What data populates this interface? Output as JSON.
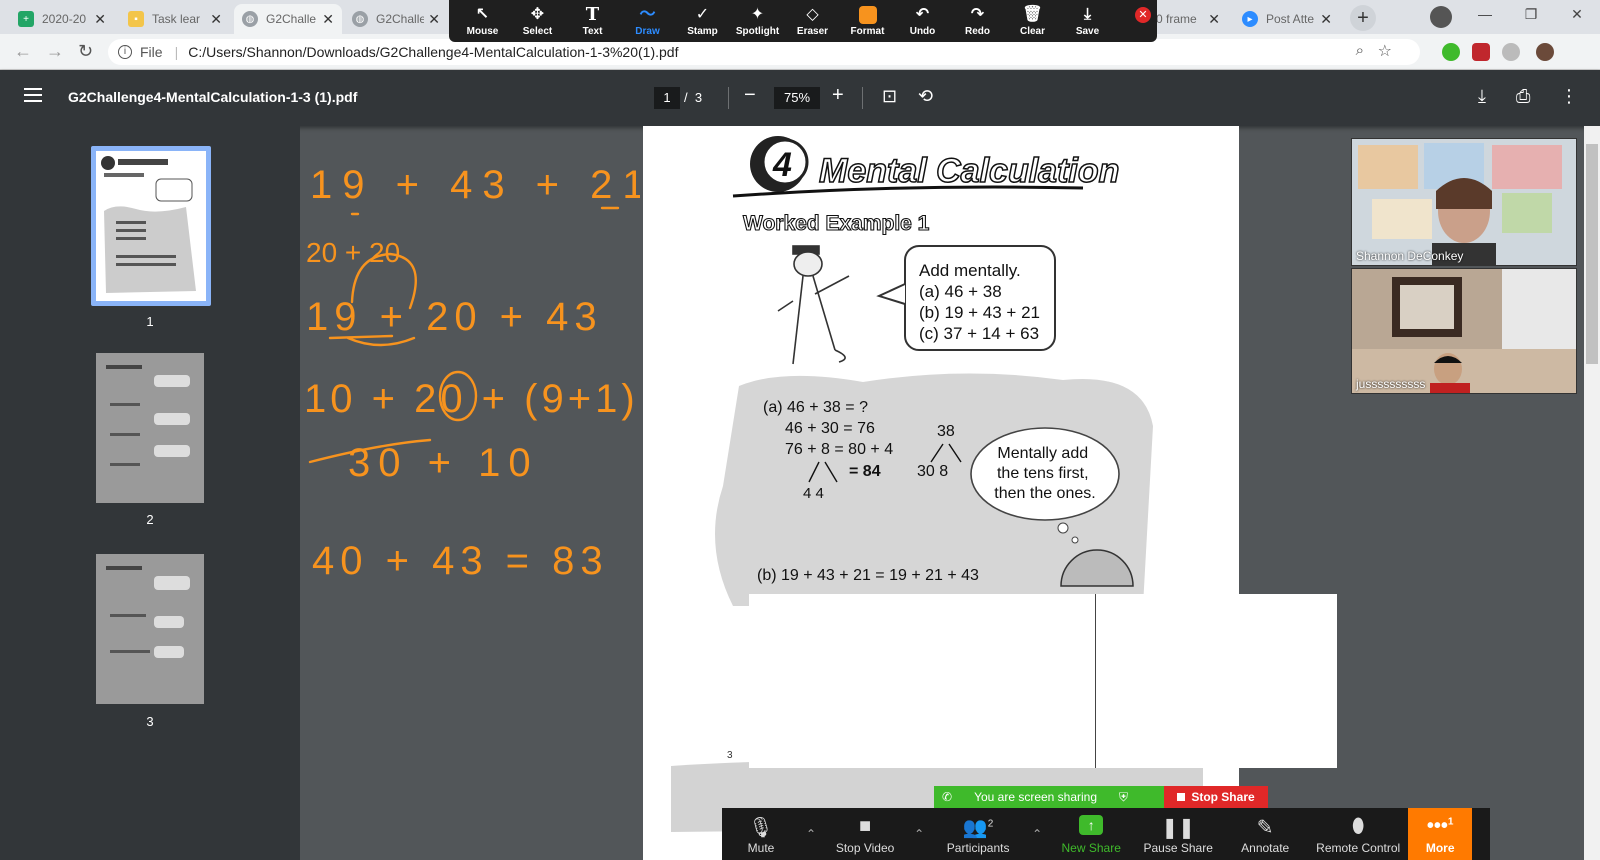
{
  "browser": {
    "tabs": [
      {
        "label": "2020-20",
        "icon": "sheets-icon"
      },
      {
        "label": "Task lear",
        "icon": "classroom-icon"
      },
      {
        "label": "G2Challe",
        "icon": "globe-icon"
      },
      {
        "label": "G2Challe",
        "icon": "globe-icon"
      },
      {
        "label": "0 frame",
        "icon": "record-icon"
      },
      {
        "label": "Post Atte",
        "icon": "zoom-icon"
      }
    ],
    "address": {
      "scheme_label": "File",
      "url": "C:/Users/Shannon/Downloads/G2Challenge4-MentalCalculation-1-3%20(1).pdf"
    }
  },
  "annotation_toolbar": {
    "tools": [
      {
        "label": "Mouse",
        "icon": "mouse-pointer-icon"
      },
      {
        "label": "Select",
        "icon": "move-icon"
      },
      {
        "label": "Text",
        "icon": "text-icon"
      },
      {
        "label": "Draw",
        "icon": "draw-icon",
        "active": true
      },
      {
        "label": "Stamp",
        "icon": "checkmark-icon"
      },
      {
        "label": "Spotlight",
        "icon": "spotlight-icon"
      },
      {
        "label": "Eraser",
        "icon": "eraser-icon"
      },
      {
        "label": "Format",
        "icon": "color-swatch-icon"
      },
      {
        "label": "Undo",
        "icon": "undo-icon"
      },
      {
        "label": "Redo",
        "icon": "redo-icon"
      },
      {
        "label": "Clear",
        "icon": "trash-icon"
      },
      {
        "label": "Save",
        "icon": "save-icon"
      }
    ],
    "format_color": "#f7931e"
  },
  "pdf": {
    "title": "G2Challenge4-MentalCalculation-1-3 (1).pdf",
    "current_page": "1",
    "page_sep": "/",
    "total_pages": "3",
    "zoom": "75%",
    "thumbnails": [
      "1",
      "2",
      "3"
    ]
  },
  "page_content": {
    "chapter_number": "4",
    "chapter_title": "Mental Calculation",
    "example_title": "Worked Example 1",
    "task_lines": [
      "Add mentally.",
      "(a) 46 + 38",
      "(b) 19 + 43 + 21",
      "(c) 37 + 14 + 63"
    ],
    "work_a": [
      "(a) 46 + 38  = ?",
      "46 + 30 = 76",
      "76 + 8   = 80 + 4",
      "= 84",
      "4      4"
    ],
    "split_38": [
      "38",
      "30    8"
    ],
    "bubble": [
      "Mentally add",
      "the tens first,",
      "then the ones."
    ],
    "work_b": "(b) 19 + 43 + 21 = 19 + 21 + 43",
    "page_corner": "3"
  },
  "handwriting": {
    "color": "#f7931e",
    "lines": [
      "19 + 43 + 21",
      "20 + 20",
      "19 + 20 + 43",
      "10 + 20 + (9+1)",
      "30 + 10",
      "40 + 43 = 83"
    ]
  },
  "video": {
    "participants": [
      {
        "name": "Shannon DeConkey"
      },
      {
        "name": "jussssssssss"
      }
    ]
  },
  "zoom": {
    "share_status": "You are screen sharing",
    "stop_share": "Stop Share",
    "controls": [
      {
        "label": "Mute",
        "icon": "microphone-icon"
      },
      {
        "label": "Stop Video",
        "icon": "video-camera-icon"
      },
      {
        "label": "Participants",
        "icon": "participants-icon",
        "badge": "2"
      },
      {
        "label": "New Share",
        "icon": "share-arrow-icon"
      },
      {
        "label": "Pause Share",
        "icon": "pause-icon"
      },
      {
        "label": "Annotate",
        "icon": "pencil-icon"
      },
      {
        "label": "Remote Control",
        "icon": "mouse-icon"
      },
      {
        "label": "More",
        "icon": "more-dots-icon",
        "badge": "1"
      }
    ],
    "share_green": "#3fba2b",
    "more_orange": "#ff7a00"
  }
}
